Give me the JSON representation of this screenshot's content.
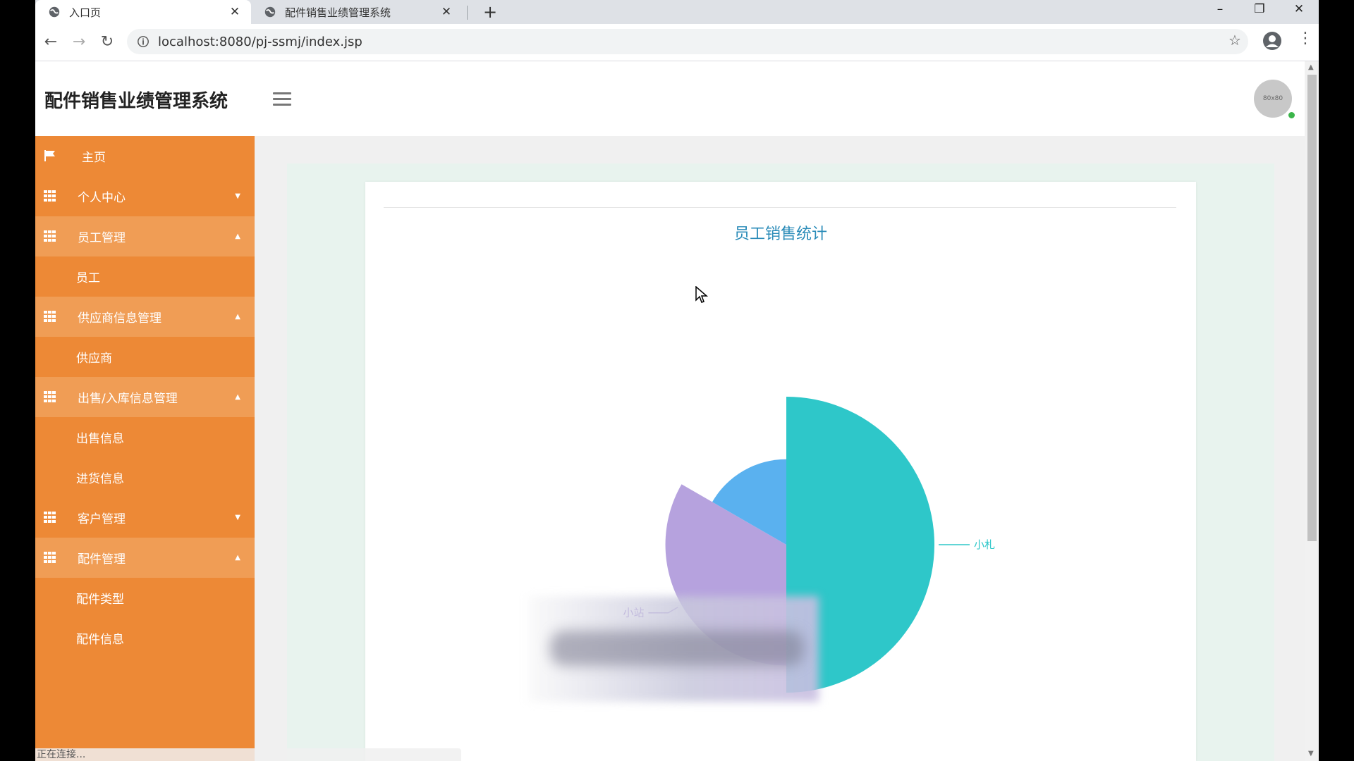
{
  "browser": {
    "tabs": [
      {
        "title": "入口页",
        "active": true
      },
      {
        "title": "配件销售业绩管理系统",
        "active": false
      }
    ],
    "new_tab": "+",
    "url": "localhost:8080/pj-ssmj/index.jsp",
    "window_controls": {
      "minimize": "–",
      "restore": "❐",
      "close": "✕"
    }
  },
  "app": {
    "title": "配件销售业绩管理系统",
    "avatar_text": "80x80"
  },
  "sidebar": {
    "items": [
      {
        "label": "主页",
        "type": "link",
        "icon": "flag-icon"
      },
      {
        "label": "个人中心",
        "type": "group",
        "open": false,
        "icon": "grid-icon"
      },
      {
        "label": "员工管理",
        "type": "group",
        "open": true,
        "icon": "grid-icon"
      },
      {
        "label": "员工",
        "type": "sub"
      },
      {
        "label": "供应商信息管理",
        "type": "group",
        "open": true,
        "icon": "grid-icon"
      },
      {
        "label": "供应商",
        "type": "sub"
      },
      {
        "label": "出售/入库信息管理",
        "type": "group",
        "open": true,
        "icon": "grid-icon"
      },
      {
        "label": "出售信息",
        "type": "sub"
      },
      {
        "label": "进货信息",
        "type": "sub"
      },
      {
        "label": "客户管理",
        "type": "group",
        "open": false,
        "icon": "grid-icon"
      },
      {
        "label": "配件管理",
        "type": "group",
        "open": true,
        "icon": "grid-icon"
      },
      {
        "label": "配件类型",
        "type": "sub"
      },
      {
        "label": "配件信息",
        "type": "sub"
      }
    ]
  },
  "chart_data": {
    "type": "pie",
    "title": "员工销售统计",
    "style": "rose",
    "slices": [
      {
        "name": "小札",
        "value": 120,
        "color": "#2ec7c9"
      },
      {
        "name": "小站",
        "value": 80,
        "color": "#b6a2de"
      },
      {
        "name": "",
        "value": 40,
        "color": "#5ab1ef"
      }
    ]
  },
  "status_text": "正在连接..."
}
